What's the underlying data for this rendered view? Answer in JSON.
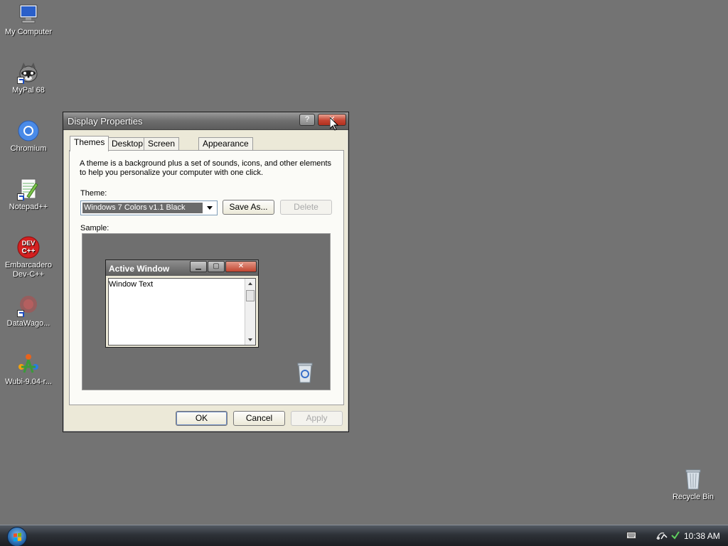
{
  "desktop": {
    "icons": [
      {
        "label": "My Computer"
      },
      {
        "label": "MyPal 68"
      },
      {
        "label": "Chromium"
      },
      {
        "label": "Notepad++"
      },
      {
        "label": "Embarcadero Dev-C++"
      },
      {
        "label": "DataWago..."
      },
      {
        "label": "Wubi-9.04-r..."
      },
      {
        "label": "Recycle Bin"
      }
    ]
  },
  "dialog": {
    "title": "Display Properties",
    "help_label": "?",
    "close_label": "✕",
    "tabs": [
      {
        "label": "Themes",
        "active": true
      },
      {
        "label": "Desktop",
        "active": false
      },
      {
        "label": "Screen Saver",
        "active": false
      },
      {
        "label": "Appearance",
        "active": false
      }
    ],
    "description": "A theme is a background plus a set of sounds, icons, and other elements to help you personalize your computer with one click.",
    "theme_label": "Theme:",
    "theme_value": "Windows 7 Colors v1.1 Black",
    "save_as_label": "Save As...",
    "delete_label": "Delete",
    "sample_label": "Sample:",
    "sample": {
      "window_title": "Active Window",
      "minimize_label": "▁",
      "maximize_label": "▢",
      "close_label": "✕",
      "window_text": "Window Text"
    },
    "ok_label": "OK",
    "cancel_label": "Cancel",
    "apply_label": "Apply"
  },
  "taskbar": {
    "clock": "10:38 AM"
  }
}
